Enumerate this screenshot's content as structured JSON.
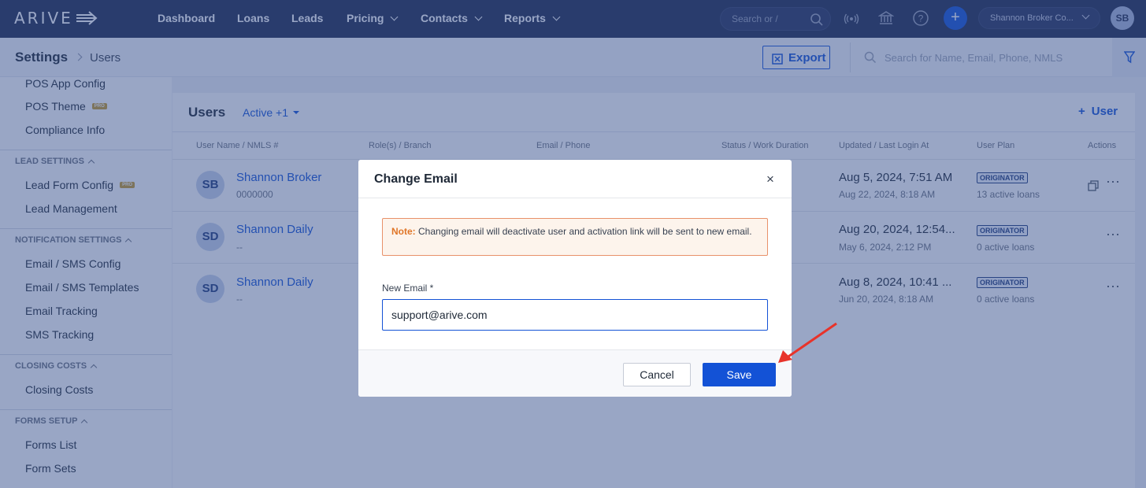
{
  "brand": {
    "logo_text": "ARIVE"
  },
  "topnav": {
    "items": [
      "Dashboard",
      "Loans",
      "Leads",
      "Pricing",
      "Contacts",
      "Reports"
    ],
    "search_placeholder": "Search or /",
    "add_symbol": "+",
    "account_name": "Shannon Broker Co...",
    "avatar_initials": "SB"
  },
  "settings_bar": {
    "breadcrumb_main": "Settings",
    "breadcrumb_sub": "Users",
    "export_label": "Export",
    "search_placeholder": "Search for Name, Email, Phone, NMLS"
  },
  "sidebar": {
    "items_top": [
      {
        "label": "POS App Config",
        "pro": false
      },
      {
        "label": "POS Theme",
        "pro": true
      },
      {
        "label": "Compliance Info",
        "pro": false
      }
    ],
    "sections": [
      {
        "title": "LEAD SETTINGS",
        "items": [
          {
            "label": "Lead Form Config",
            "pro": true
          },
          {
            "label": "Lead Management",
            "pro": false
          }
        ]
      },
      {
        "title": "NOTIFICATION SETTINGS",
        "items": [
          {
            "label": "Email / SMS Config"
          },
          {
            "label": "Email / SMS Templates"
          },
          {
            "label": "Email Tracking"
          },
          {
            "label": "SMS Tracking"
          }
        ]
      },
      {
        "title": "CLOSING COSTS",
        "items": [
          {
            "label": "Closing Costs"
          }
        ]
      },
      {
        "title": "FORMS SETUP",
        "items": [
          {
            "label": "Forms List"
          },
          {
            "label": "Form Sets"
          }
        ]
      }
    ],
    "pro_badge": "PRO"
  },
  "users_panel": {
    "title": "Users",
    "filter_label": "Active +1",
    "add_label": "User",
    "columns": [
      "User Name / NMLS #",
      "Role(s) / Branch",
      "Email / Phone",
      "Status / Work Duration",
      "Updated / Last Login At",
      "User Plan",
      "Actions"
    ],
    "rows": [
      {
        "initials": "SB",
        "name": "Shannon Broker",
        "nmls": "0000000",
        "updated": "Aug 5, 2024, 7:51 AM",
        "last_login": "Aug 22, 2024, 8:18 AM",
        "plan": "ORIGINATOR",
        "loans": "13 active loans"
      },
      {
        "initials": "SD",
        "name": "Shannon Daily",
        "nmls": "--",
        "updated": "Aug 20, 2024, 12:54...",
        "last_login": "May 6, 2024, 2:12 PM",
        "plan": "ORIGINATOR",
        "loans": "0 active loans"
      },
      {
        "initials": "SD",
        "name": "Shannon Daily",
        "nmls": "--",
        "updated": "Aug 8, 2024, 10:41 ...",
        "last_login": "Jun 20, 2024, 8:18 AM",
        "plan": "ORIGINATOR",
        "loans": "0 active loans"
      }
    ]
  },
  "modal": {
    "title": "Change Email",
    "close_symbol": "×",
    "note_label": "Note:",
    "note_text": " Changing email will deactivate user and activation link will be sent to new email.",
    "field_label": "New Email *",
    "field_value": "support@arive.com",
    "cancel_label": "Cancel",
    "save_label": "Save"
  },
  "colors": {
    "primary": "#1352d6",
    "nav_bg": "#1e2a4f",
    "annotation_arrow": "#e8332a",
    "note_accent": "#e07628"
  }
}
